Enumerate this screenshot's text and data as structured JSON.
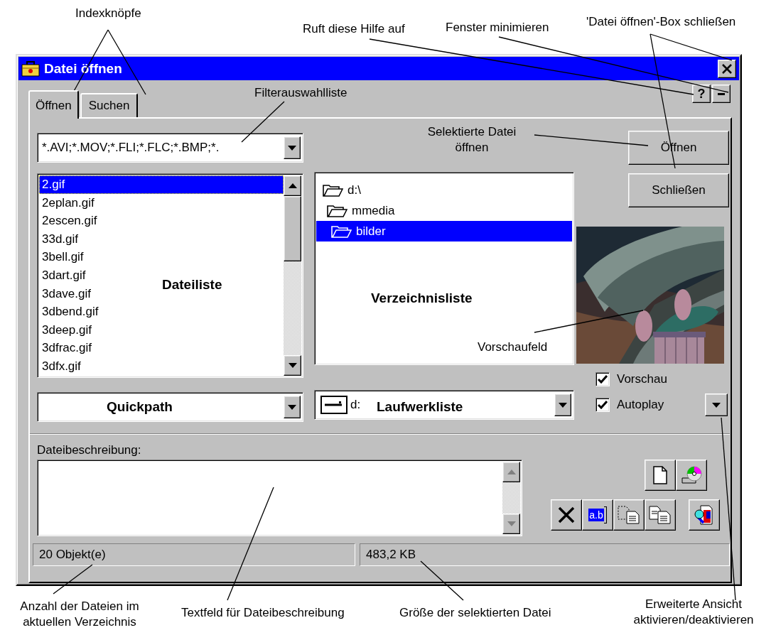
{
  "window": {
    "title": "Datei öffnen",
    "help": "?"
  },
  "tabs": [
    {
      "label": "Öffnen",
      "selected": true
    },
    {
      "label": "Suchen",
      "selected": false
    }
  ],
  "filter": {
    "value": "*.AVI;*.MOV;*.FLI;*.FLC;*.BMP;*."
  },
  "files": [
    {
      "name": "2.gif",
      "selected": true
    },
    {
      "name": "2eplan.gif",
      "selected": false
    },
    {
      "name": "2escen.gif",
      "selected": false
    },
    {
      "name": "33d.gif",
      "selected": false
    },
    {
      "name": "3bell.gif",
      "selected": false
    },
    {
      "name": "3dart.gif",
      "selected": false
    },
    {
      "name": "3dave.gif",
      "selected": false
    },
    {
      "name": "3dbend.gif",
      "selected": false
    },
    {
      "name": "3deep.gif",
      "selected": false
    },
    {
      "name": "3dfrac.gif",
      "selected": false
    },
    {
      "name": "3dfx.gif",
      "selected": false
    }
  ],
  "directories": [
    {
      "name": "d:\\",
      "selected": false,
      "children": [
        {
          "name": "mmedia",
          "selected": false,
          "children": [
            {
              "name": "bilder",
              "selected": true
            }
          ]
        }
      ]
    }
  ],
  "drive": {
    "value": "d:"
  },
  "buttons": [
    {
      "label": "Öffnen"
    },
    {
      "label": "Schließen"
    }
  ],
  "options": [
    {
      "label": "Vorschau",
      "checked": true
    },
    {
      "label": "Autoplay",
      "checked": true
    }
  ],
  "description": {
    "label": "Dateibeschreibung:"
  },
  "toolbar": [
    {
      "kind": "new"
    },
    {
      "kind": "disc"
    },
    {
      "kind": "delete"
    },
    {
      "kind": "rename",
      "text": "a.b"
    },
    {
      "kind": "copy"
    },
    {
      "kind": "paste"
    },
    {
      "kind": "view"
    }
  ],
  "status_bar": [
    "20 Objekt(e)",
    "483,2 KB"
  ],
  "annotations": [
    {
      "text": "Indexknöpfe",
      "kind": "callout"
    },
    {
      "text": "Filterauswahlliste",
      "kind": "callout"
    },
    {
      "text": "Ruft diese Hilfe auf",
      "kind": "callout"
    },
    {
      "text": "Fenster minimieren",
      "kind": "callout"
    },
    {
      "text": "'Datei öffnen'-Box schließen",
      "kind": "callout"
    },
    {
      "text": "Selektierte Datei öffnen",
      "kind": "callout"
    },
    {
      "text": "Dateiliste",
      "kind": "region"
    },
    {
      "text": "Verzeichnisliste",
      "kind": "region"
    },
    {
      "text": "Vorschaufeld",
      "kind": "callout"
    },
    {
      "text": "Quickpath",
      "kind": "region"
    },
    {
      "text": "Laufwerkliste",
      "kind": "region"
    },
    {
      "text": "Anzahl der Dateien im aktuellen Verzeichnis",
      "kind": "callout"
    },
    {
      "text": "Textfeld für Dateibeschreibung",
      "kind": "callout"
    },
    {
      "text": "Größe der selektierten Datei",
      "kind": "callout"
    },
    {
      "text": "Erweiterte Ansicht aktivieren/deaktivieren",
      "kind": "callout"
    }
  ]
}
